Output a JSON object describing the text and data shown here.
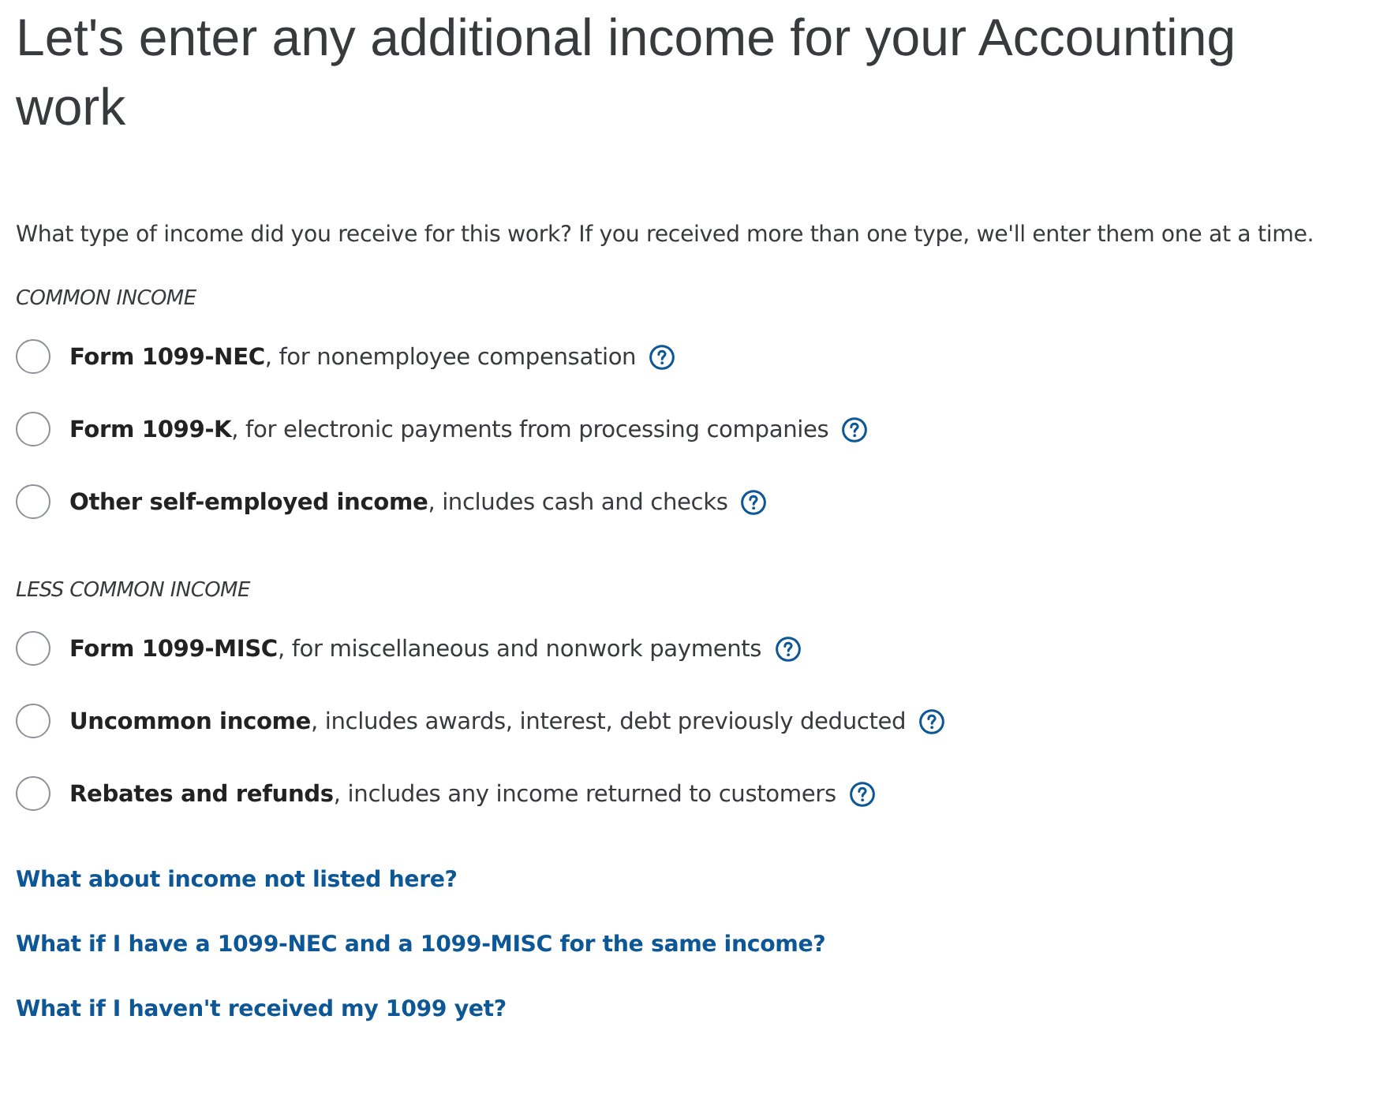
{
  "title": "Let's enter any additional income for your Accounting work",
  "question": "What type of income did you receive for this work? If you received more than one type, we'll enter them one at a time.",
  "groups": [
    {
      "heading": "COMMON INCOME",
      "options": [
        {
          "label": "**Form 1099-NEC**, for nonemployee compensation",
          "selected": false
        },
        {
          "label": "**Form 1099-K**, for electronic payments from processing companies",
          "selected": false
        },
        {
          "label": "**Other self-employed income**, includes cash and checks",
          "selected": false
        }
      ]
    },
    {
      "heading": "LESS COMMON INCOME",
      "options": [
        {
          "label": "**Form 1099-MISC**, for miscellaneous and nonwork payments",
          "selected": false
        },
        {
          "label": "**Uncommon income**, includes awards, interest, debt previously deducted",
          "selected": false
        },
        {
          "label": "**Rebates and refunds**, includes any income returned to customers",
          "selected": false
        }
      ]
    }
  ],
  "links": [
    "What about income not listed here?",
    "What if I have a 1099-NEC and a 1099-MISC for the same income?",
    "What if I haven't received my 1099 yet?"
  ]
}
